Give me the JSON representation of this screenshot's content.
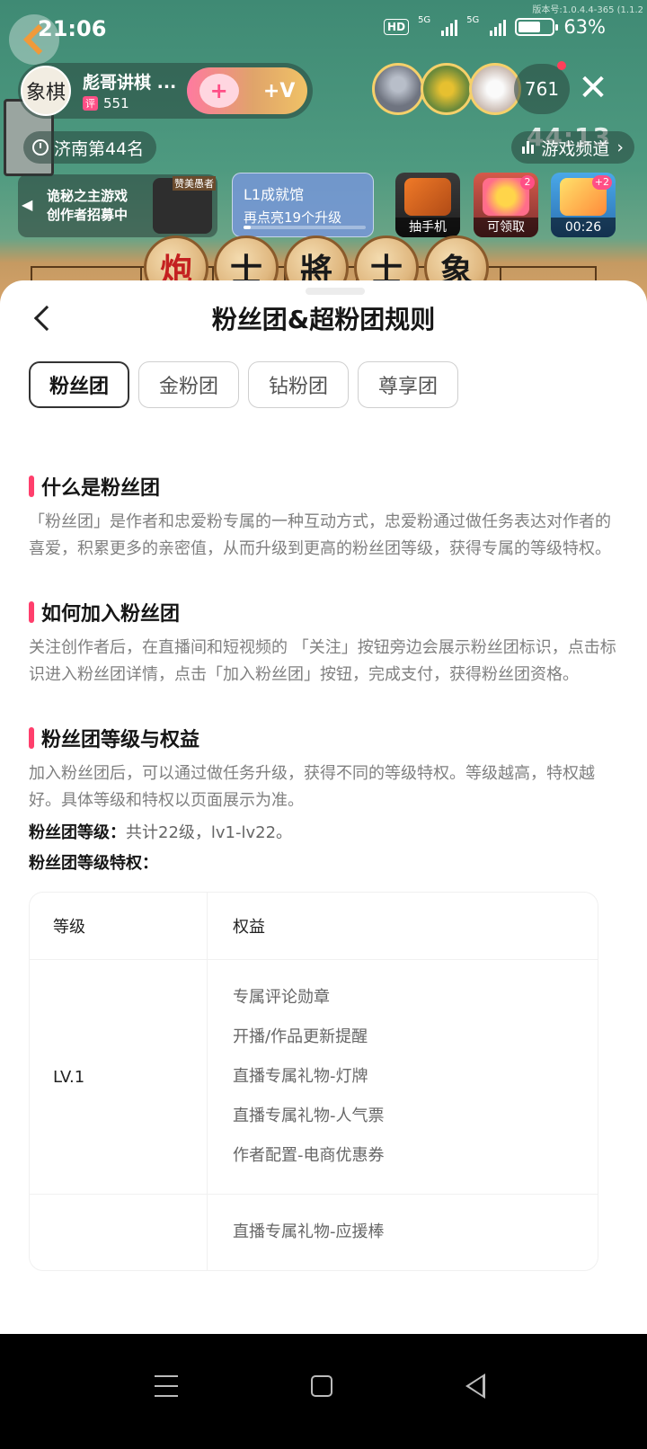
{
  "status": {
    "time": "21:06",
    "hd": "HD",
    "net1": "5G",
    "net2": "5G",
    "battery": "63%",
    "version": "版本号:1.0.4.4-365 (1.1.2"
  },
  "live": {
    "host_name": "彪哥讲棋 ...",
    "host_avatar_text": "象棋",
    "host_stat_tag": "评",
    "host_stat": "551",
    "follow_plus": "+",
    "follow_v": "+V",
    "viewer_count": "761",
    "close_icon": "close-icon",
    "rank_text": "济南第44名",
    "channel_label": "游戏频道",
    "score_overlay": "44:13",
    "promo": {
      "line1": "诡秘之主游戏",
      "line2": "创作者招募中",
      "tag": "赞美愚者"
    },
    "achievement": {
      "title": "L1成就馆",
      "subtitle": "再点亮19个升级",
      "progress": 0.06
    },
    "activities": [
      {
        "label": "抽手机",
        "badge": ""
      },
      {
        "label": "可领取",
        "badge": "2"
      },
      {
        "label": "00:26",
        "badge": "+2"
      }
    ],
    "chess_pieces": [
      "炮",
      "士",
      "將",
      "士",
      "象"
    ]
  },
  "sheet": {
    "title": "粉丝团&超粉团规则",
    "tabs": [
      "粉丝团",
      "金粉团",
      "钻粉团",
      "尊享团"
    ],
    "active_tab": 0,
    "sections": [
      {
        "heading": "什么是粉丝团",
        "body": "「粉丝团」是作者和忠爱粉专属的一种互动方式，忠爱粉通过做任务表达对作者的喜爱，积累更多的亲密值，从而升级到更高的粉丝团等级，获得专属的等级特权。"
      },
      {
        "heading": "如何加入粉丝团",
        "body": "关注创作者后，在直播间和短视频的 「关注」按钮旁边会展示粉丝团标识，点击标识进入粉丝团详情，点击「加入粉丝团」按钮，完成支付，获得粉丝团资格。"
      },
      {
        "heading": "粉丝团等级与权益",
        "body": "加入粉丝团后，可以通过做任务升级，获得不同的等级特权。等级越高，特权越好。具体等级和特权以页面展示为准。"
      }
    ],
    "level_count_label": "粉丝团等级：",
    "level_count_value": "共计22级，lv1-lv22。",
    "level_privilege_label": "粉丝团等级特权：",
    "table": {
      "headers": [
        "等级",
        "权益"
      ],
      "rows": [
        {
          "level": "LV.1",
          "benefits": [
            "专属评论勋章",
            "开播/作品更新提醒",
            "直播专属礼物-灯牌",
            "直播专属礼物-人气票",
            "作者配置-电商优惠券"
          ]
        },
        {
          "level": "",
          "benefits": [
            "直播专属礼物-应援棒"
          ]
        }
      ]
    }
  }
}
